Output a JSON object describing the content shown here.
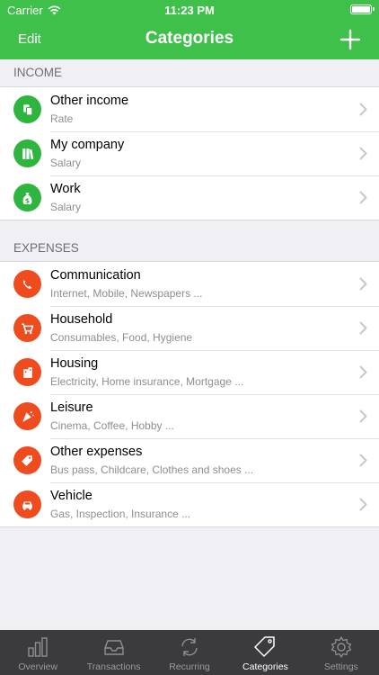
{
  "status_bar": {
    "carrier": "Carrier",
    "time": "11:23 PM",
    "battery_level": 1.0
  },
  "nav": {
    "edit_label": "Edit",
    "title": "Categories",
    "add_icon": "plus-icon"
  },
  "colors": {
    "brand_green": "#3fc04b",
    "income_green": "#2fb53f",
    "expense_orange": "#ee4b1e",
    "tab_bar_bg": "#3b3b3d"
  },
  "income": {
    "header": "INCOME",
    "items": [
      {
        "name": "Other income",
        "sub": "Rate",
        "icon": "coins-icon"
      },
      {
        "name": "My company",
        "sub": "Salary",
        "icon": "books-icon"
      },
      {
        "name": "Work",
        "sub": "Salary",
        "icon": "money-bag-icon"
      }
    ]
  },
  "expenses": {
    "header": "EXPENSES",
    "items": [
      {
        "name": "Communication",
        "sub": "Internet, Mobile, Newspapers ...",
        "icon": "phone-icon"
      },
      {
        "name": "Household",
        "sub": "Consumables, Food, Hygiene",
        "icon": "cart-icon"
      },
      {
        "name": "Housing",
        "sub": "Electricity, Home insurance, Mortgage ...",
        "icon": "building-icon"
      },
      {
        "name": "Leisure",
        "sub": "Cinema, Coffee, Hobby ...",
        "icon": "party-icon"
      },
      {
        "name": "Other expenses",
        "sub": "Bus pass, Childcare, Clothes and shoes ...",
        "icon": "tag-icon"
      },
      {
        "name": "Vehicle",
        "sub": "Gas, Inspection, Insurance ...",
        "icon": "car-icon"
      }
    ]
  },
  "tabs": [
    {
      "label": "Overview",
      "icon": "bar-chart-icon",
      "active": false
    },
    {
      "label": "Transactions",
      "icon": "inbox-tray-icon",
      "active": false
    },
    {
      "label": "Recurring",
      "icon": "repeat-icon",
      "active": false
    },
    {
      "label": "Categories",
      "icon": "tag-icon",
      "active": true
    },
    {
      "label": "Settings",
      "icon": "gear-icon",
      "active": false
    }
  ]
}
